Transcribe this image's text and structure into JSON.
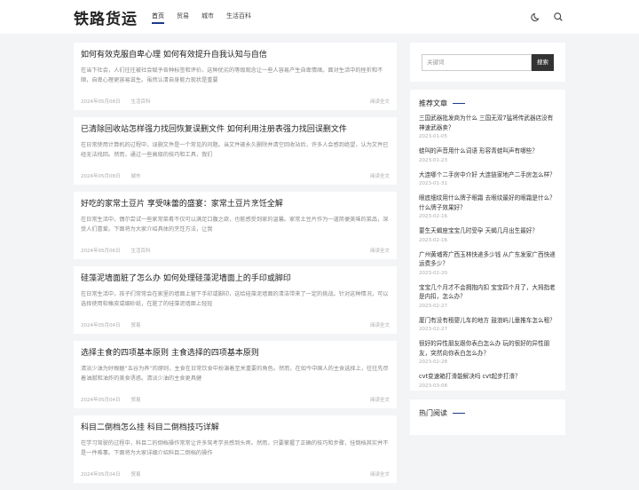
{
  "header": {
    "logo": "铁路货运",
    "nav": [
      "首页",
      "贸易",
      "城市",
      "生活百科"
    ]
  },
  "articles": [
    {
      "title": "如何有效克服自卑心理 如何有效提升自我认知与自信",
      "excerpt": "在当下社会，人们往往被社会赋予各种标签和评价。这种优劣的等级观念让一些人容易产生自卑情绪。面对生活中的挫折和不顺，自卑心理更容易滋生。虽然认清自身能力现状是重要",
      "date": "2024年05月08日",
      "category": "生活百科",
      "more": "阅读全文"
    },
    {
      "title": "已清除回收站怎样强力找回恢复误删文件 如何利用注册表强力找回误删文件",
      "excerpt": "在日常使用计算机的过程中，误删文件是一个常见的问题。当文件被永久删除并清空回收站后，许多人会感到绝望，认为文件已经无法找回。然而，通过一些高级的技巧和工具，我们",
      "date": "2024年05月08日",
      "category": "城市",
      "more": "阅读全文"
    },
    {
      "title": "好吃的家常土豆片 享受味蕾的盛宴：家常土豆片烹饪全解",
      "excerpt": "在日常生活中，偶尔尝试一些家常菜肴不仅可以满足口腹之欲，也能感受到家的温馨。家常土豆片作为一道简便美味的菜品，深受人们喜爱。下面将为大家介绍具体的烹饪方法，让我",
      "date": "2024年05月06日",
      "category": "生活百科",
      "more": "阅读全文"
    },
    {
      "title": "硅藻泥墙面脏了怎么办 如何处理硅藻泥墙面上的手印或脚印",
      "excerpt": "在日常生活中，孩子们常常会在家里的墙面上留下手印或脚印，这给硅藻泥墙面的清洁带来了一定的挑战。针对这种情况，可以选择使用软橡皮或细砂纸，在脏了的硅藻泥墙面上轻轻",
      "date": "2024年05月04日",
      "category": "贸易",
      "more": "阅读全文"
    },
    {
      "title": "选择主食的四项基本原则 主食选择的四项基本原则",
      "excerpt": "清淡少油为好根据“五谷为养”的原则，主食在日常饮食中扮演着至关重要的角色。然而，在如今中国人的主食选择上，往往先尽着油腻和油炸的美食诱惑。清淡少油的主食更具健",
      "date": "2024年05月04日",
      "category": "贸易",
      "more": "阅读全文"
    },
    {
      "title": "科目二倒档怎么挂 科目二倒档技巧详解",
      "excerpt": "在学习驾驶的过程中，科目二的倒档操作常常让许多驾考学员感到头疼。然而，只要掌握了正确的技巧和步骤，挂倒档其实并不是一件难事。下面将为大家详细介绍科目二倒档的操作",
      "date": "2024年05月04日",
      "category": "贸易",
      "more": "阅读全文"
    }
  ],
  "search": {
    "placeholder": "关键词",
    "button": "搜索"
  },
  "recommended": {
    "title": "推荐文章",
    "items": [
      {
        "title": "三国武器批发商为什么 三国无双7猛将传武器店没有神速武器卖？",
        "date": "2023-01-05"
      },
      {
        "title": "蛙叫的声音用什么词语 形容青蛙叫声有哪些？",
        "date": "2023-01-23"
      },
      {
        "title": "大连哪个二手房中介好 大连链家地产二手房怎么样？",
        "date": "2023-01-31"
      },
      {
        "title": "眼底细纹用什么牌子眼霜 去眼纹最好的眼霜是什么？什么牌子效果好？",
        "date": "2023-02-16"
      },
      {
        "title": "要生天蝎座宝宝几时受孕 天蝎几月出生最好？",
        "date": "2023-02-16"
      },
      {
        "title": "广州黄埔寄广西玉林快递多少钱 从广东发家广西快递运费多少？",
        "date": "2023-02-20"
      },
      {
        "title": "宝宝几个月才不会拥抱内扣 宝宝四个月了，大拇指老是内扣，怎么办？",
        "date": "2023-02-27"
      },
      {
        "title": "厦门有没有租婴儿车的地方 鼓浪屿儿童推车怎么租？",
        "date": "2023-02-27"
      },
      {
        "title": "很好的异性朋友跟你表白怎么办 玩的很好的异性朋友，突然向你表白怎么办？",
        "date": "2023-02-28"
      },
      {
        "title": "cvt变速箱打滑能解决吗 cvt起步打滑？",
        "date": "2023-03-08"
      }
    ]
  },
  "hot": {
    "title": "热门阅读"
  }
}
